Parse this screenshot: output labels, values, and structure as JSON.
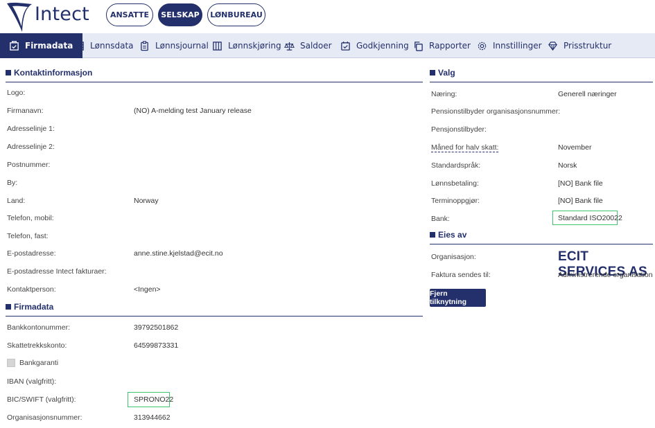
{
  "app": {
    "name": "Intect"
  },
  "top_tabs": [
    {
      "label": "ANSATTE"
    },
    {
      "label": "SELSKAP"
    },
    {
      "label": "LØNBUREAU"
    }
  ],
  "nav": [
    {
      "label": "Firmadata",
      "icon": "building-icon"
    },
    {
      "label": "Lønnsdata",
      "icon": "table-icon"
    },
    {
      "label": "Lønnsjournal",
      "icon": "clipboard-icon"
    },
    {
      "label": "Lønnskjøring",
      "icon": "columns-icon"
    },
    {
      "label": "Saldoer",
      "icon": "scale-icon"
    },
    {
      "label": "Godkjenning",
      "icon": "calendar-check-icon"
    },
    {
      "label": "Rapporter",
      "icon": "copy-icon"
    },
    {
      "label": "Innstillinger",
      "icon": "gear-icon"
    },
    {
      "label": "Prisstruktur",
      "icon": "diamond-icon"
    }
  ],
  "contact": {
    "title": "Kontaktinformasjon",
    "rows": [
      {
        "label": "Logo:",
        "value": ""
      },
      {
        "label": "Firmanavn:",
        "value": "(NO) A-melding test January release"
      },
      {
        "label": "Adresselinje 1:",
        "value": ""
      },
      {
        "label": "Adresselinje 2:",
        "value": ""
      },
      {
        "label": "Postnummer:",
        "value": ""
      },
      {
        "label": "By:",
        "value": ""
      },
      {
        "label": "Land:",
        "value": "Norway"
      },
      {
        "label": "Telefon, mobil:",
        "value": ""
      },
      {
        "label": "Telefon, fast:",
        "value": ""
      },
      {
        "label": "E-postadresse:",
        "value": "anne.stine.kjelstad@ecit.no"
      },
      {
        "label": "E-postadresse Intect fakturaer:",
        "value": ""
      },
      {
        "label": "Kontaktperson:",
        "value": "<Ingen>"
      }
    ]
  },
  "firmadata": {
    "title": "Firmadata",
    "bankkonto_label": "Bankkontonummer:",
    "bankkonto_value": "39792501862",
    "skattetrekk_label": "Skattetrekkskonto:",
    "skattetrekk_value": "64599873331",
    "bankgaranti_label": "Bankgaranti",
    "iban_label": "IBAN (valgfritt):",
    "iban_value": "",
    "bic_label": "BIC/SWIFT (valgfritt):",
    "bic_value": "SPRONO22",
    "orgnr_label": "Organisasjonsnummer:",
    "orgnr_value": "313944662"
  },
  "valg": {
    "title": "Valg",
    "rows": [
      {
        "label": "Næring:",
        "value": "Generell næringer"
      },
      {
        "label": "Pensionstilbyder organisasjonsnummer:",
        "value": ""
      },
      {
        "label": "Pensjonstilbyder:",
        "value": ""
      },
      {
        "label": "Måned for halv skatt:",
        "value": "November"
      },
      {
        "label": "Standardspråk:",
        "value": "Norsk"
      },
      {
        "label": "Lønnsbetaling:",
        "value": "[NO] Bank file"
      },
      {
        "label": "Terminoppgjør:",
        "value": "[NO] Bank file"
      },
      {
        "label": "Bank:",
        "value": "Standard ISO20022"
      }
    ]
  },
  "eies_av": {
    "title": "Eies av",
    "org_label": "Organisasjon:",
    "org_value": "ECIT SERVICES AS",
    "faktura_label": "Faktura sendes til:",
    "faktura_value": "Administrerende organisation",
    "button_label": "Fjern tilknytning"
  },
  "colors": {
    "primary": "#24306b",
    "highlight": "#3ec46d",
    "nav_bg": "#e6eaf4"
  }
}
